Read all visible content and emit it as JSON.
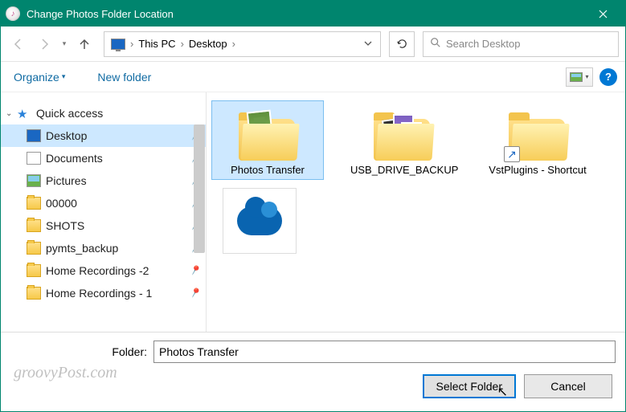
{
  "title": "Change Photos Folder Location",
  "breadcrumbs": {
    "root": "This PC",
    "leaf": "Desktop"
  },
  "search": {
    "placeholder": "Search Desktop"
  },
  "toolbar": {
    "organize": "Organize",
    "newfolder": "New folder"
  },
  "tree": {
    "quick_access": "Quick access",
    "items": [
      {
        "label": "Desktop",
        "icon": "monitor",
        "pinned": true,
        "selected": true
      },
      {
        "label": "Documents",
        "icon": "doc",
        "pinned": true
      },
      {
        "label": "Pictures",
        "icon": "pic",
        "pinned": true
      },
      {
        "label": "00000",
        "icon": "fld",
        "pinned": true
      },
      {
        "label": "SHOTS",
        "icon": "fld",
        "pinned": true
      },
      {
        "label": "pymts_backup",
        "icon": "fld",
        "pinned": true
      },
      {
        "label": "Home Recordings -2",
        "icon": "fld",
        "pinned": true
      },
      {
        "label": "Home Recordings - 1",
        "icon": "fld",
        "pinned": true
      }
    ]
  },
  "items": [
    {
      "label": "Photos Transfer",
      "kind": "folder-thumb1",
      "selected": true
    },
    {
      "label": "USB_DRIVE_BACKUP",
      "kind": "folder-thumb2"
    },
    {
      "label": "VstPlugins - Shortcut",
      "kind": "folder-shortcut"
    },
    {
      "label": "",
      "kind": "cloud"
    }
  ],
  "footer": {
    "label": "Folder:",
    "value": "Photos Transfer",
    "select": "Select Folder",
    "cancel": "Cancel"
  },
  "watermark": "groovyPost.com"
}
